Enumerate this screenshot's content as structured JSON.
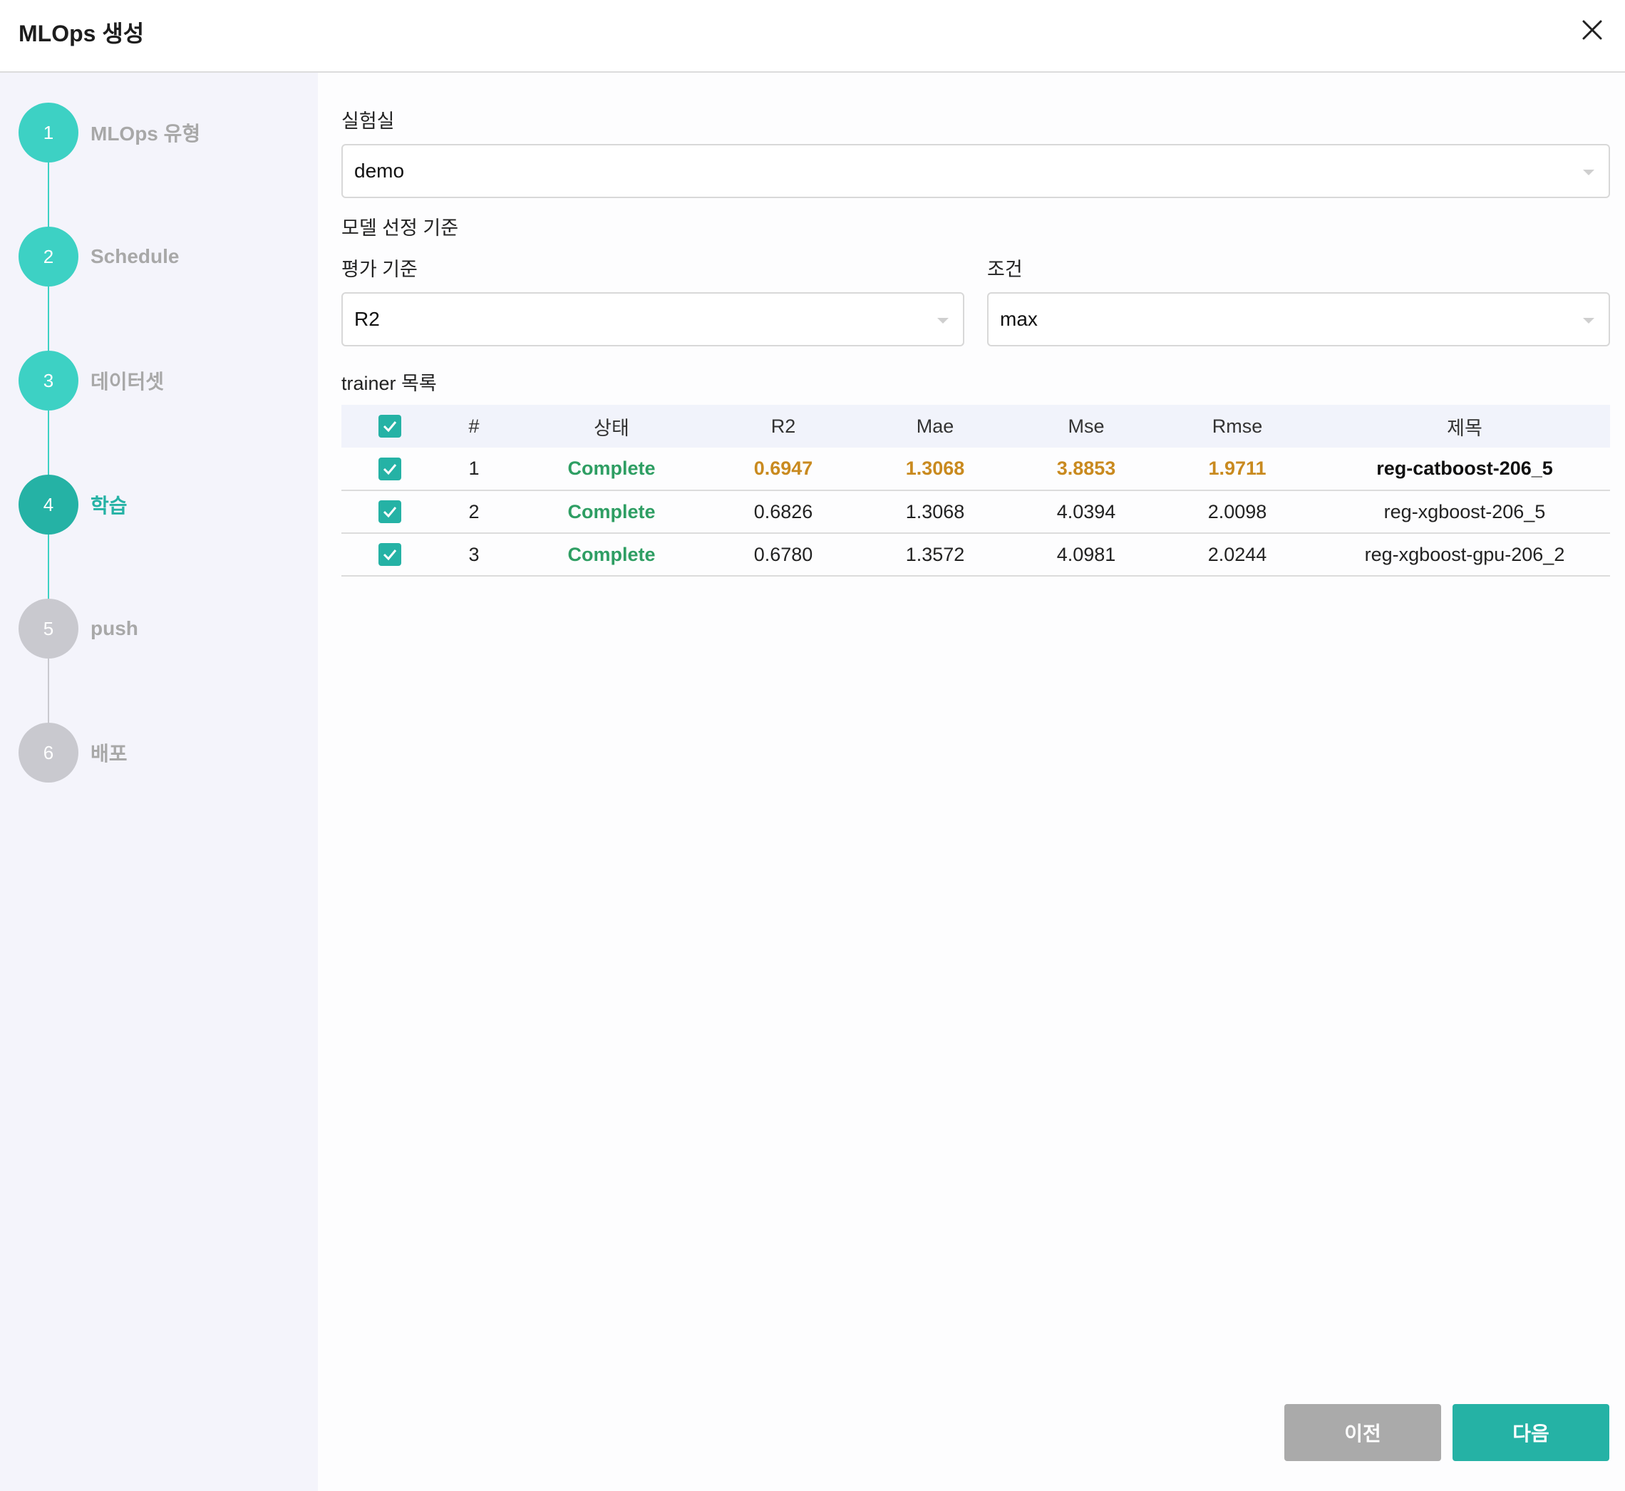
{
  "window": {
    "title": "MLOps 생성"
  },
  "steps": [
    {
      "num": "1",
      "label": "MLOps 유형"
    },
    {
      "num": "2",
      "label": "Schedule"
    },
    {
      "num": "3",
      "label": "데이터셋"
    },
    {
      "num": "4",
      "label": "학습"
    },
    {
      "num": "5",
      "label": "push"
    },
    {
      "num": "6",
      "label": "배포"
    }
  ],
  "form": {
    "lab_label": "실험실",
    "lab_value": "demo",
    "criteria_label": "모델 선정 기준",
    "metric_label": "평가 기준",
    "metric_value": "R2",
    "condition_label": "조건",
    "condition_value": "max",
    "trainer_list_label": "trainer 목록"
  },
  "table": {
    "headers": [
      "#",
      "상태",
      "R2",
      "Mae",
      "Mse",
      "Rmse",
      "제목"
    ],
    "rows": [
      {
        "num": "1",
        "status": "Complete",
        "r2": "0.6947",
        "mae": "1.3068",
        "mse": "3.8853",
        "rmse": "1.9711",
        "title": "reg-catboost-206_5"
      },
      {
        "num": "2",
        "status": "Complete",
        "r2": "0.6826",
        "mae": "1.3068",
        "mse": "4.0394",
        "rmse": "2.0098",
        "title": "reg-xgboost-206_5"
      },
      {
        "num": "3",
        "status": "Complete",
        "r2": "0.6780",
        "mae": "1.3572",
        "mse": "4.0981",
        "rmse": "2.0244",
        "title": "reg-xgboost-gpu-206_2"
      }
    ]
  },
  "buttons": {
    "prev": "이전",
    "next": "다음"
  },
  "colors": {
    "accent": "#25b2a5",
    "step_done": "#3dd1c4",
    "step_active": "#25b2a5",
    "step_pending": "#c9c9cf",
    "status_complete": "#2e9e63",
    "best_value": "#c98a1f",
    "prev_button": "#aaaaaa"
  }
}
